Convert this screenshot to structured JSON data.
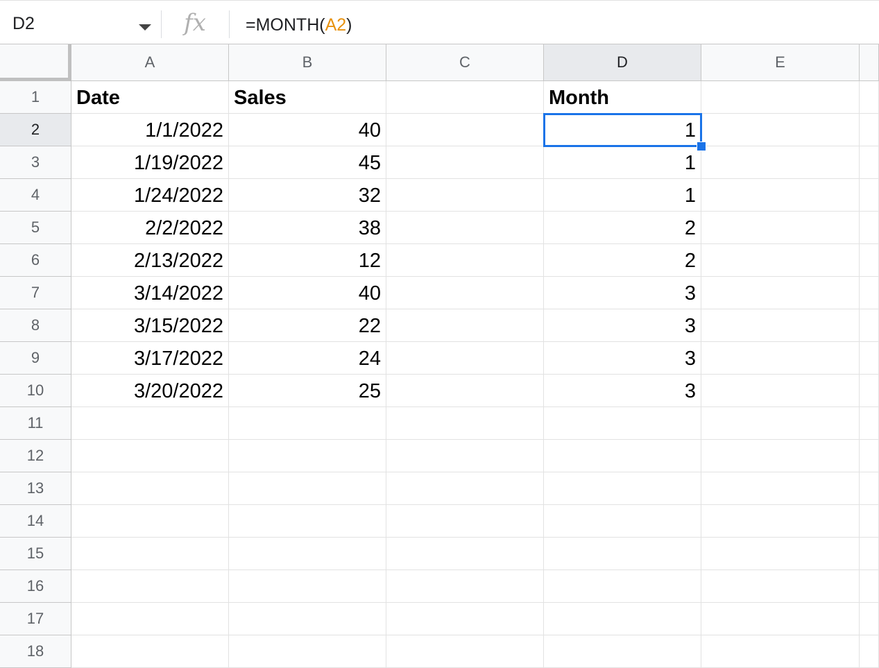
{
  "name_box": "D2",
  "fx_label": "fx",
  "formula": {
    "prefix": "=MONTH(",
    "ref": "A2",
    "suffix": ")"
  },
  "columns": [
    "A",
    "B",
    "C",
    "D",
    "E"
  ],
  "rows": [
    "1",
    "2",
    "3",
    "4",
    "5",
    "6",
    "7",
    "8",
    "9",
    "10",
    "11",
    "12",
    "13",
    "14",
    "15",
    "16",
    "17",
    "18"
  ],
  "headers": {
    "A": "Date",
    "B": "Sales",
    "D": "Month"
  },
  "data": [
    {
      "date": "1/1/2022",
      "sales": "40",
      "month": "1"
    },
    {
      "date": "1/19/2022",
      "sales": "45",
      "month": "1"
    },
    {
      "date": "1/24/2022",
      "sales": "32",
      "month": "1"
    },
    {
      "date": "2/2/2022",
      "sales": "38",
      "month": "2"
    },
    {
      "date": "2/13/2022",
      "sales": "12",
      "month": "2"
    },
    {
      "date": "3/14/2022",
      "sales": "40",
      "month": "3"
    },
    {
      "date": "3/15/2022",
      "sales": "22",
      "month": "3"
    },
    {
      "date": "3/17/2022",
      "sales": "24",
      "month": "3"
    },
    {
      "date": "3/20/2022",
      "sales": "25",
      "month": "3"
    }
  ],
  "selected_cell": "D2",
  "colors": {
    "selection": "#1a73e8",
    "formula_ref": "#e8920f"
  }
}
